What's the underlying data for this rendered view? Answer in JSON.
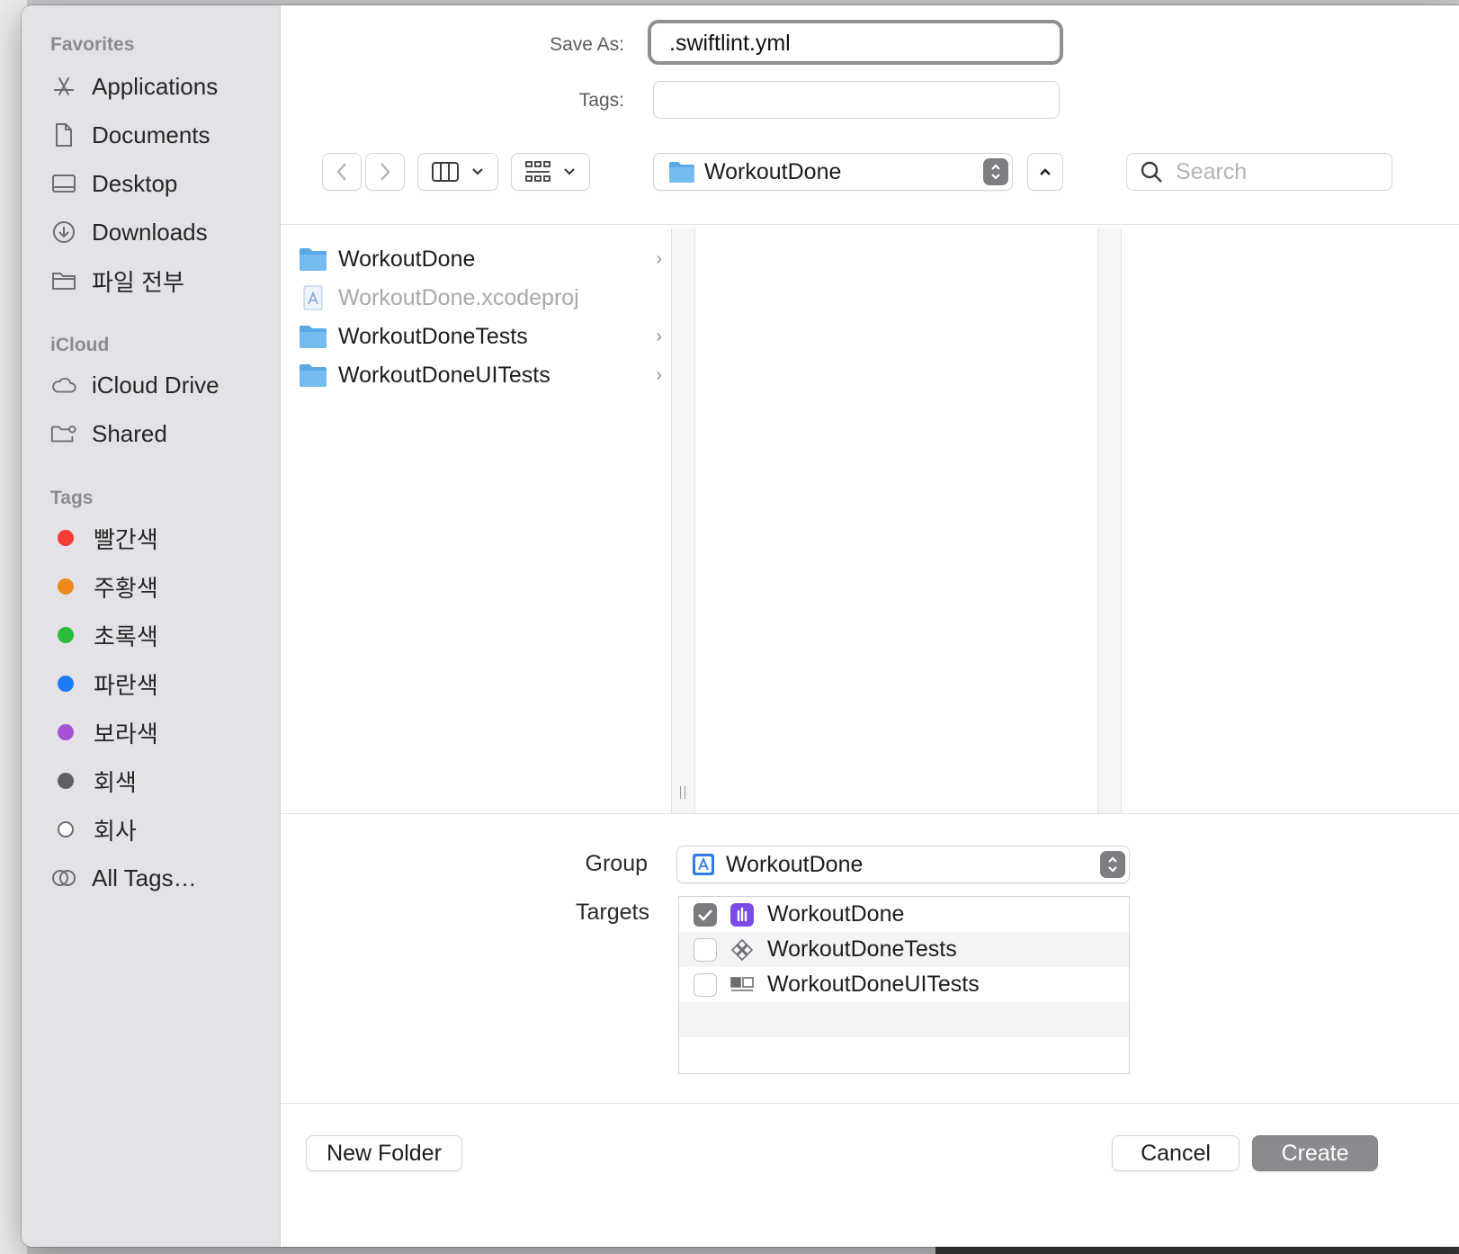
{
  "sidebar": {
    "favorites_title": "Favorites",
    "favorites": [
      {
        "label": "Applications",
        "icon": "applications-icon"
      },
      {
        "label": "Documents",
        "icon": "document-icon"
      },
      {
        "label": "Desktop",
        "icon": "desktop-icon"
      },
      {
        "label": "Downloads",
        "icon": "download-icon"
      },
      {
        "label": "파일 전부",
        "icon": "folder-icon"
      }
    ],
    "icloud_title": "iCloud",
    "icloud": [
      {
        "label": "iCloud Drive",
        "icon": "cloud-icon"
      },
      {
        "label": "Shared",
        "icon": "shared-folder-icon"
      }
    ],
    "tags_title": "Tags",
    "tags": [
      {
        "label": "빨간색",
        "color": "#f23c35"
      },
      {
        "label": "주황색",
        "color": "#f08a1c"
      },
      {
        "label": "초록색",
        "color": "#2bbd3a"
      },
      {
        "label": "파란색",
        "color": "#1b7bf5"
      },
      {
        "label": "보라색",
        "color": "#a552d8"
      },
      {
        "label": "회색",
        "color": "#5e5e63"
      },
      {
        "label": "회사",
        "color": "#ffffff"
      },
      {
        "label": "All Tags…",
        "color": ""
      }
    ]
  },
  "header": {
    "save_as_label": "Save As:",
    "save_as_value": ".swiftlint.yml",
    "tags_label": "Tags:",
    "location": "WorkoutDone",
    "search_placeholder": "Search"
  },
  "browser": {
    "items": [
      {
        "name": "WorkoutDone",
        "kind": "folder",
        "has_children": true,
        "dimmed": false
      },
      {
        "name": "WorkoutDone.xcodeproj",
        "kind": "xcodeproj",
        "has_children": false,
        "dimmed": true
      },
      {
        "name": "WorkoutDoneTests",
        "kind": "folder",
        "has_children": true,
        "dimmed": false
      },
      {
        "name": "WorkoutDoneUITests",
        "kind": "folder",
        "has_children": true,
        "dimmed": false
      }
    ]
  },
  "options": {
    "group_label": "Group",
    "group_value": "WorkoutDone",
    "targets_label": "Targets",
    "targets": [
      {
        "name": "WorkoutDone",
        "checked": true,
        "icon": "app-target-icon"
      },
      {
        "name": "WorkoutDoneTests",
        "checked": false,
        "icon": "unit-test-target-icon"
      },
      {
        "name": "WorkoutDoneUITests",
        "checked": false,
        "icon": "ui-test-target-icon"
      }
    ]
  },
  "footer": {
    "new_folder": "New Folder",
    "cancel": "Cancel",
    "create": "Create"
  },
  "colors": {
    "sidebar_bg": "#e4e2e7",
    "folder_blue": "#5aa9e6",
    "primary_button": "#8a8a8f"
  }
}
